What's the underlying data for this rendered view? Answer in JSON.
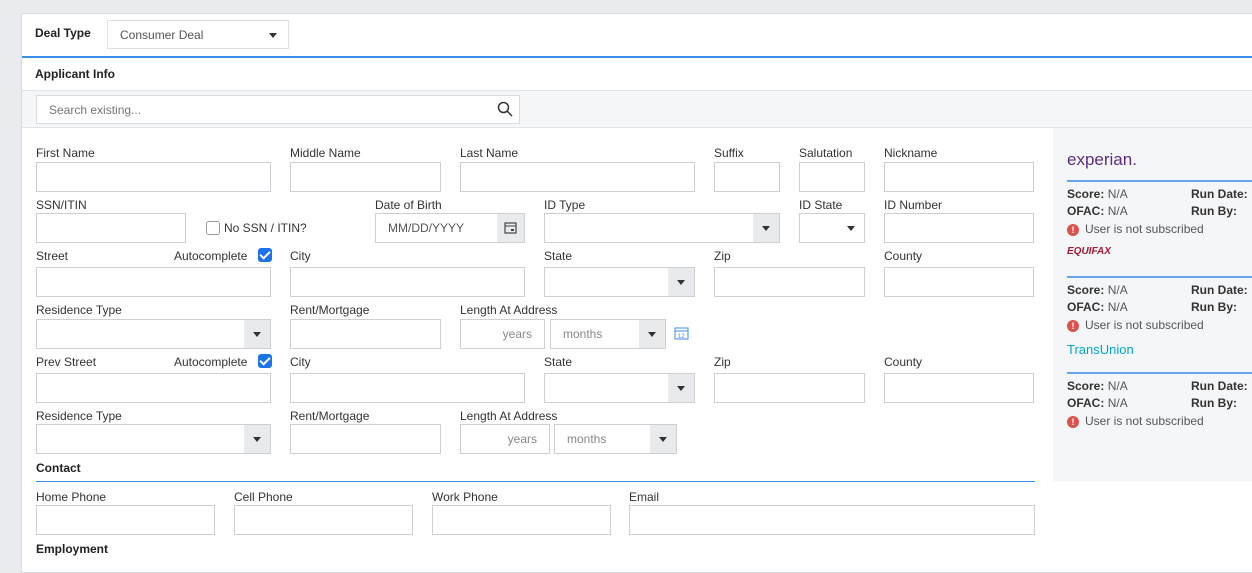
{
  "deal": {
    "label": "Deal Type",
    "value": "Consumer Deal"
  },
  "applicant": {
    "title": "Applicant Info",
    "search_placeholder": "Search existing..."
  },
  "fields": {
    "first_name": "First Name",
    "middle_name": "Middle Name",
    "last_name": "Last Name",
    "suffix": "Suffix",
    "salutation": "Salutation",
    "nickname": "Nickname",
    "ssn": "SSN/ITIN",
    "no_ssn": "No SSN / ITIN?",
    "dob": "Date of Birth",
    "dob_placeholder": "MM/DD/YYYY",
    "id_type": "ID Type",
    "id_state": "ID State",
    "id_number": "ID Number",
    "street": "Street",
    "autocomplete": "Autocomplete",
    "city": "City",
    "state": "State",
    "zip": "Zip",
    "county": "County",
    "residence_type": "Residence Type",
    "rent": "Rent/Mortgage",
    "length": "Length At Address",
    "years": "years",
    "months": "months",
    "prev_street": "Prev Street"
  },
  "contact": {
    "title": "Contact",
    "home": "Home Phone",
    "cell": "Cell Phone",
    "work": "Work Phone",
    "email": "Email"
  },
  "employment": {
    "title": "Employment"
  },
  "bureaus": [
    {
      "name": "experian.",
      "color": "#5a2d82"
    },
    {
      "name": "EQUIFAX",
      "color": "#9e1b32"
    },
    {
      "name": "TransUnion",
      "color": "#00a6ca"
    }
  ],
  "bureau_labels": {
    "score": "Score:",
    "ofac": "OFAC:",
    "run_date": "Run Date:",
    "run_by": "Run By:",
    "na": "N/A",
    "not_subscribed": "User is not subscribed"
  }
}
